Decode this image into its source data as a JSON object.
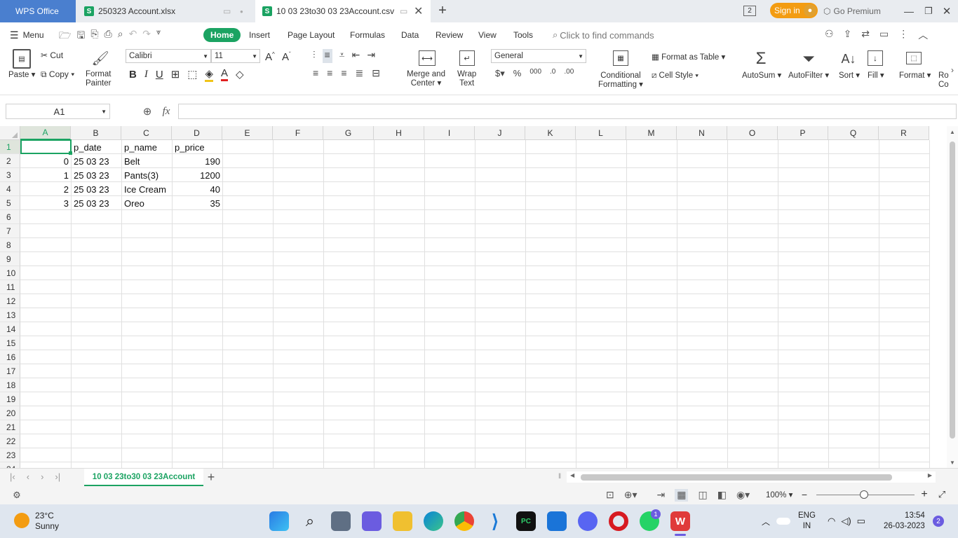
{
  "titlebar": {
    "app_tab": "WPS Office",
    "doc_tab_1": "250323  Account.xlsx",
    "doc_tab_2": "10 03 23to30 03 23Account.csv",
    "window_count": "2",
    "sign_in": "Sign in",
    "premium": "Go Premium"
  },
  "menu": {
    "menu_label": "Menu",
    "tabs": [
      "Home",
      "Insert",
      "Page Layout",
      "Formulas",
      "Data",
      "Review",
      "View",
      "Tools"
    ],
    "search_placeholder": "Click to find commands"
  },
  "ribbon": {
    "paste": "Paste",
    "cut": "Cut",
    "copy": "Copy",
    "format_painter_1": "Format",
    "format_painter_2": "Painter",
    "font_name": "Calibri",
    "font_size": "11",
    "merge_1": "Merge and",
    "merge_2": "Center",
    "wrap_1": "Wrap",
    "wrap_2": "Text",
    "number_format": "General",
    "cond_1": "Conditional",
    "cond_2": "Formatting",
    "format_as_table": "Format as Table",
    "cell_style": "Cell Style",
    "autosum": "AutoSum",
    "autofilter": "AutoFilter",
    "sort": "Sort",
    "fill": "Fill",
    "format": "Format",
    "rows_cols_1": "Ro",
    "rows_cols_2": "Co"
  },
  "formula_bar": {
    "name_box": "A1",
    "fx": "fx",
    "formula": ""
  },
  "grid": {
    "columns": [
      "A",
      "B",
      "C",
      "D",
      "E",
      "F",
      "G",
      "H",
      "I",
      "J",
      "K",
      "L",
      "M",
      "N",
      "O",
      "P",
      "Q",
      "R"
    ],
    "rows": [
      "1",
      "2",
      "3",
      "4",
      "5",
      "6",
      "7",
      "8",
      "9",
      "10",
      "11",
      "12",
      "13",
      "14",
      "15",
      "16",
      "17",
      "18",
      "19",
      "20",
      "21",
      "22",
      "23",
      "24"
    ],
    "header_row": [
      "",
      "p_date",
      "p_name",
      "p_price"
    ],
    "data": [
      [
        "0",
        "25 03 23",
        "Belt",
        "190"
      ],
      [
        "1",
        "25 03 23",
        "Pants(3)",
        "1200"
      ],
      [
        "2",
        "25 03 23",
        "Ice Cream",
        "40"
      ],
      [
        "3",
        "25 03 23",
        "Oreo",
        "35"
      ]
    ]
  },
  "sheet_tabs": {
    "active": "10 03 23to30 03 23Account"
  },
  "status": {
    "zoom": "100%"
  },
  "taskbar": {
    "temperature": "23°C",
    "weather": "Sunny",
    "language_1": "ENG",
    "language_2": "IN",
    "time": "13:54",
    "date": "26-03-2023",
    "notifications": "2",
    "whatsapp_badge": "1"
  },
  "colors": {
    "accent": "#1ba362",
    "wps_tab": "#4a7fcf",
    "sign_in": "#f39c12"
  }
}
